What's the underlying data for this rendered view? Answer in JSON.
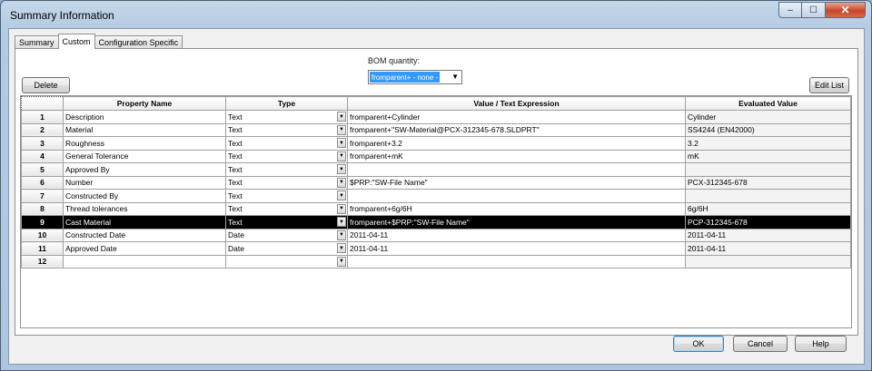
{
  "window": {
    "title": "Summary Information",
    "minimize": "–",
    "maximize": "☐",
    "close": "✕"
  },
  "tabs": [
    {
      "label": "Summary",
      "active": false
    },
    {
      "label": "Custom",
      "active": true
    },
    {
      "label": "Configuration Specific",
      "active": false
    }
  ],
  "toolbar": {
    "delete_label": "Delete",
    "bom_label": "BOM quantity:",
    "bom_value": "fromparent+ - none -",
    "edit_list_label": "Edit List"
  },
  "grid": {
    "columns": [
      "",
      "Property Name",
      "Type",
      "Value / Text Expression",
      "Evaluated Value"
    ],
    "rows": [
      {
        "num": "1",
        "name": "Description",
        "type": "Text",
        "value": "fromparent+Cylinder",
        "evaluated": "Cylinder"
      },
      {
        "num": "2",
        "name": "Material",
        "type": "Text",
        "value": "fromparent+\"SW-Material@PCX-312345-678.SLDPRT\"",
        "evaluated": "SS4244 (EN42000)"
      },
      {
        "num": "3",
        "name": "Roughness",
        "type": "Text",
        "value": "fromparent+3.2",
        "evaluated": "3.2"
      },
      {
        "num": "4",
        "name": "General Tolerance",
        "type": "Text",
        "value": "fromparent+mK",
        "evaluated": "mK"
      },
      {
        "num": "5",
        "name": "Approved By",
        "type": "Text",
        "value": "",
        "evaluated": ""
      },
      {
        "num": "6",
        "name": "Number",
        "type": "Text",
        "value": "$PRP:\"SW-File Name\"",
        "evaluated": "PCX-312345-678"
      },
      {
        "num": "7",
        "name": "Constructed By",
        "type": "Text",
        "value": "",
        "evaluated": ""
      },
      {
        "num": "8",
        "name": "Thread tolerances",
        "type": "Text",
        "value": "fromparent+6g/6H",
        "evaluated": "6g/6H"
      },
      {
        "num": "9",
        "name": "Cast Material",
        "type": "Text",
        "value": "fromparent+$PRP:\"SW-File Name\"",
        "evaluated": "PCP-312345-678",
        "selected": true
      },
      {
        "num": "10",
        "name": "Constructed Date",
        "type": "Date",
        "value": "2011-04-11",
        "evaluated": "2011-04-11"
      },
      {
        "num": "11",
        "name": "Approved Date",
        "type": "Date",
        "value": "2011-04-11",
        "evaluated": "2011-04-11"
      },
      {
        "num": "12",
        "name": "",
        "type": "",
        "value": "",
        "evaluated": ""
      }
    ]
  },
  "footer": {
    "ok_label": "OK",
    "cancel_label": "Cancel",
    "help_label": "Help"
  }
}
